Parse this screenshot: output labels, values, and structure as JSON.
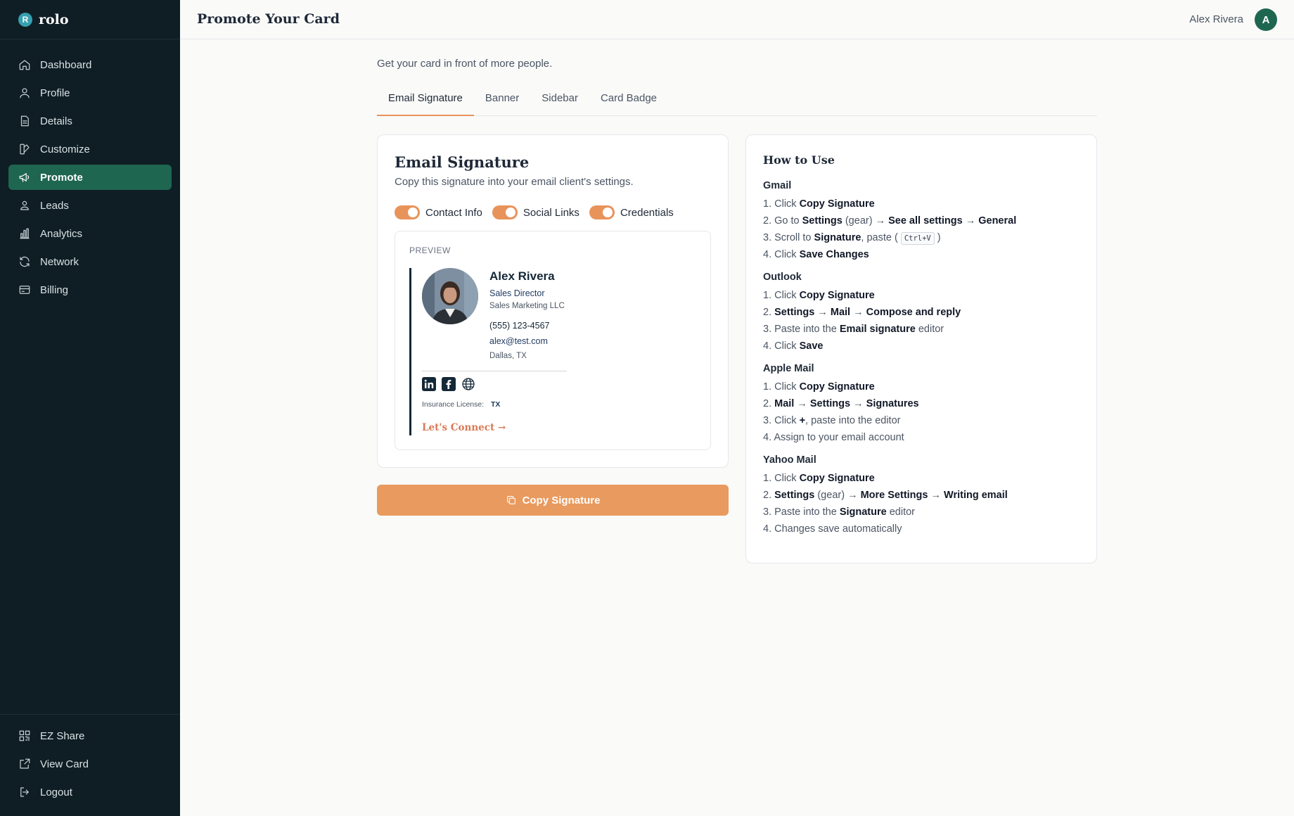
{
  "brand": {
    "logo_letter": "R",
    "name": "rolo"
  },
  "sidebar": {
    "items": [
      {
        "label": "Dashboard",
        "icon": "home-icon"
      },
      {
        "label": "Profile",
        "icon": "user-icon"
      },
      {
        "label": "Details",
        "icon": "document-icon"
      },
      {
        "label": "Customize",
        "icon": "palette-icon"
      },
      {
        "label": "Promote",
        "icon": "megaphone-icon",
        "active": true
      },
      {
        "label": "Leads",
        "icon": "contact-icon"
      },
      {
        "label": "Analytics",
        "icon": "bar-chart-icon"
      },
      {
        "label": "Network",
        "icon": "refresh-icon"
      },
      {
        "label": "Billing",
        "icon": "credit-card-icon"
      }
    ],
    "bottom_items": [
      {
        "label": "EZ Share",
        "icon": "qr-code-icon"
      },
      {
        "label": "View Card",
        "icon": "external-link-icon"
      },
      {
        "label": "Logout",
        "icon": "logout-icon"
      }
    ]
  },
  "header": {
    "title": "Promote Your Card",
    "user_name": "Alex Rivera",
    "avatar_letter": "A"
  },
  "main": {
    "subtitle": "Get your card in front of more people.",
    "tabs": [
      {
        "label": "Email Signature",
        "active": true
      },
      {
        "label": "Banner"
      },
      {
        "label": "Sidebar"
      },
      {
        "label": "Card Badge"
      }
    ]
  },
  "signature_card": {
    "title": "Email Signature",
    "description": "Copy this signature into your email client's settings.",
    "toggles": [
      {
        "label": "Contact Info",
        "on": true
      },
      {
        "label": "Social Links",
        "on": true
      },
      {
        "label": "Credentials",
        "on": true
      }
    ],
    "preview_label": "PREVIEW",
    "name": "Alex Rivera",
    "role": "Sales Director",
    "company": "Sales Marketing LLC",
    "phone": "(555) 123-4567",
    "email": "alex@test.com",
    "location": "Dallas, TX",
    "social_icons": [
      "linkedin-icon",
      "facebook-icon",
      "globe-icon"
    ],
    "credential_label": "Insurance License:",
    "credential_value": "TX",
    "cta": "Let's Connect →",
    "copy_button": "Copy Signature"
  },
  "how_to_use": {
    "title": "How to Use",
    "clients": [
      {
        "name": "Gmail",
        "steps": [
          [
            "1. Click ",
            {
              "b": "Copy Signature"
            }
          ],
          [
            "2. Go to ",
            {
              "b": "Settings"
            },
            " (gear) → ",
            {
              "b": "See all settings"
            },
            " → ",
            {
              "b": "General"
            }
          ],
          [
            "3. Scroll to ",
            {
              "b": "Signature"
            },
            ", paste ( ",
            {
              "k": "Ctrl+V"
            },
            " )"
          ],
          [
            "4. Click ",
            {
              "b": "Save Changes"
            }
          ]
        ]
      },
      {
        "name": "Outlook",
        "steps": [
          [
            "1. Click ",
            {
              "b": "Copy Signature"
            }
          ],
          [
            "2. ",
            {
              "b": "Settings"
            },
            " → ",
            {
              "b": "Mail"
            },
            " → ",
            {
              "b": "Compose and reply"
            }
          ],
          [
            "3. Paste into the ",
            {
              "b": "Email signature"
            },
            " editor"
          ],
          [
            "4. Click ",
            {
              "b": "Save"
            }
          ]
        ]
      },
      {
        "name": "Apple Mail",
        "steps": [
          [
            "1. Click ",
            {
              "b": "Copy Signature"
            }
          ],
          [
            "2. ",
            {
              "b": "Mail"
            },
            " → ",
            {
              "b": "Settings"
            },
            " → ",
            {
              "b": "Signatures"
            }
          ],
          [
            "3. Click ",
            {
              "b": "+"
            },
            ", paste into the editor"
          ],
          [
            "4. Assign to your email account"
          ]
        ]
      },
      {
        "name": "Yahoo Mail",
        "steps": [
          [
            "1. Click ",
            {
              "b": "Copy Signature"
            }
          ],
          [
            "2. ",
            {
              "b": "Settings"
            },
            " (gear) → ",
            {
              "b": "More Settings"
            },
            " → ",
            {
              "b": "Writing email"
            }
          ],
          [
            "3. Paste into the ",
            {
              "b": "Signature"
            },
            " editor"
          ],
          [
            "4. Changes save automatically"
          ]
        ]
      }
    ]
  },
  "colors": {
    "sidebar_bg": "#0f1e24",
    "active_nav": "#1f6651",
    "accent": "#e99a5e",
    "navy": "#142837"
  }
}
